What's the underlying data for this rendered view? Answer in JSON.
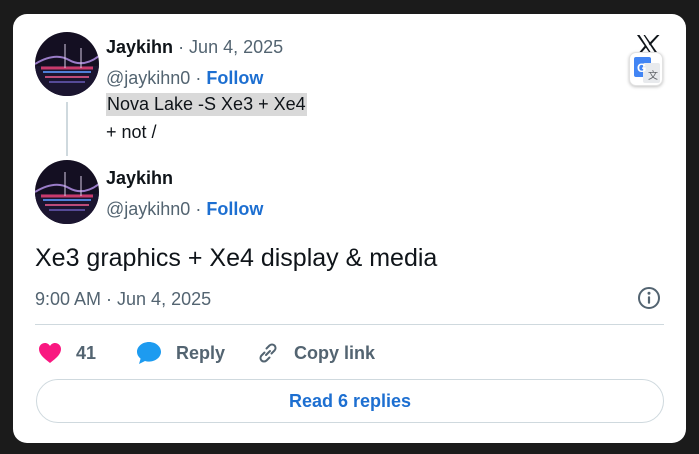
{
  "parent_tweet": {
    "author_name": "Jaykihn",
    "date": "· Jun 4, 2025",
    "handle": "@jaykihn0 ·",
    "follow_label": "Follow",
    "text_line1": "Nova Lake -S Xe3 + Xe4",
    "text_line2": "+ not /"
  },
  "main_tweet": {
    "author_name": "Jaykihn",
    "handle": "@jaykihn0 ·",
    "follow_label": "Follow",
    "text": "Xe3 graphics + Xe4 display & media",
    "timestamp": "9:00 AM · Jun 4, 2025"
  },
  "actions": {
    "like_count": "41",
    "reply_label": "Reply",
    "copy_link_label": "Copy link"
  },
  "read_replies_label": "Read 6 replies",
  "colors": {
    "like": "#f91880",
    "reply": "#1d9bf0",
    "link": "#1d6fd1",
    "muted": "#536471"
  },
  "icons": [
    "x-logo-icon",
    "translate-icon",
    "info-icon",
    "heart-icon",
    "reply-bubble-icon",
    "link-icon"
  ]
}
